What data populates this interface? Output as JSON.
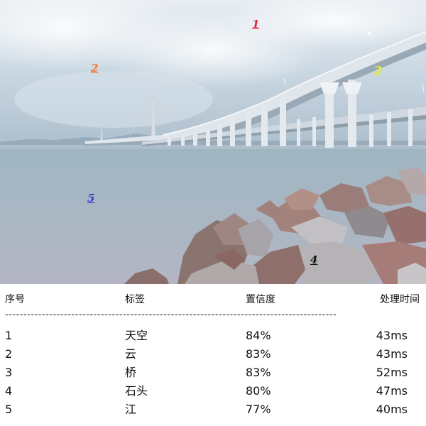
{
  "markers": [
    {
      "num": "1",
      "color": "#e8203a"
    },
    {
      "num": "2",
      "color": "#f07a2c"
    },
    {
      "num": "3",
      "color": "#ecef1f"
    },
    {
      "num": "4",
      "color": "#111111"
    },
    {
      "num": "5",
      "color": "#3a3ad0"
    }
  ],
  "table": {
    "headers": {
      "index": "序号",
      "label": "标签",
      "confidence": "置信度",
      "time": "处理时间"
    },
    "separator": "------------------------------------------------------------------------------------------",
    "rows": [
      {
        "index": "1",
        "label": "天空",
        "confidence": "84%",
        "time": "43ms"
      },
      {
        "index": "2",
        "label": "云",
        "confidence": "83%",
        "time": "43ms"
      },
      {
        "index": "3",
        "label": "桥",
        "confidence": "83%",
        "time": "52ms"
      },
      {
        "index": "4",
        "label": "石头",
        "confidence": "80%",
        "time": "47ms"
      },
      {
        "index": "5",
        "label": "江",
        "confidence": "77%",
        "time": "40ms"
      }
    ]
  }
}
